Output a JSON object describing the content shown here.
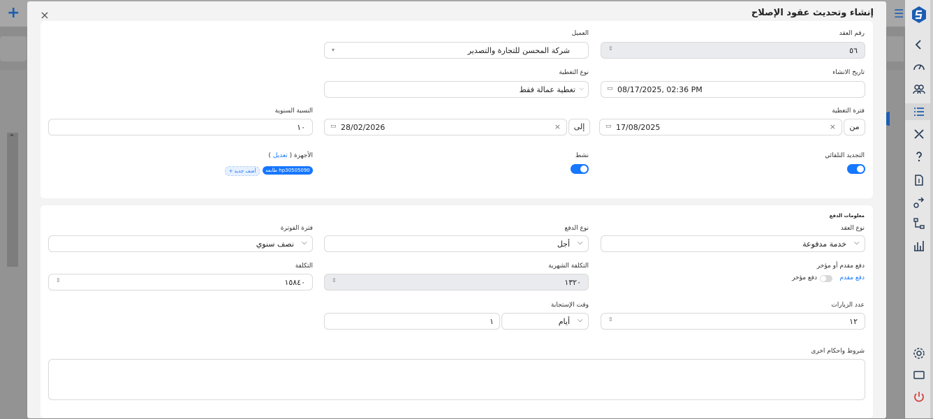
{
  "modal": {
    "title": "إنشاء وتحديث عقود الإصلاح",
    "close_symbol": "×"
  },
  "form": {
    "contract_no": {
      "label": "رقم العقد",
      "value": "٥٦"
    },
    "client": {
      "label": "العميل",
      "value": "شركة المحسن للتجارة والتصدير"
    },
    "created_at": {
      "label": "تاريخ الانشاء",
      "value": "08/17/2025, 02:36 PM"
    },
    "coverage_type": {
      "label": "نوع التغطية",
      "value": "تغطية عمالة فقط"
    },
    "coverage_period": {
      "label": "فترة التغطية",
      "from_label": "من",
      "from_value": "17/08/2025",
      "to_label": "إلى",
      "to_value": "28/02/2026"
    },
    "annual_rate": {
      "label": "النسبة السنوية",
      "value": "١٠"
    },
    "auto_renew": {
      "label": "التجديد التلقائي",
      "on": true
    },
    "active": {
      "label": "نشط",
      "on": true
    },
    "devices": {
      "label": "الأجهزة (",
      "edit_link": "تعديل",
      "label_close": ")",
      "tag": "طابعه hp30505090",
      "add_tag": "+ أضف جديد"
    }
  },
  "payment": {
    "section_title": "معلومات الدفع",
    "contract_type": {
      "label": "نوع العقد",
      "value": "خدمة مدفوعة"
    },
    "payment_type": {
      "label": "نوع الدفع",
      "value": "أجل"
    },
    "invoice_period": {
      "label": "فترة الفوترة",
      "value": "نصف سنوي"
    },
    "prepay_postpay": {
      "label": "دفع مقدم أو مؤخر",
      "option_left": "دفع مؤخر",
      "option_right": "دفع مقدم"
    },
    "monthly_cost": {
      "label": "التكلفة الشهرية",
      "value": "١٣٢٠"
    },
    "cost": {
      "label": "التكلفة",
      "value": "١٥٨٤٠"
    },
    "visits": {
      "label": "عدد الزيارات",
      "value": "١٢"
    },
    "response_time": {
      "label": "وقت الإستجابة",
      "unit": "أيام",
      "value": "١"
    },
    "terms": {
      "label": "شروط واحكام اخرى",
      "value": ""
    }
  },
  "colors": {
    "accent": "#1677ff",
    "brand": "#1b5db3",
    "danger": "#d32f2f"
  }
}
